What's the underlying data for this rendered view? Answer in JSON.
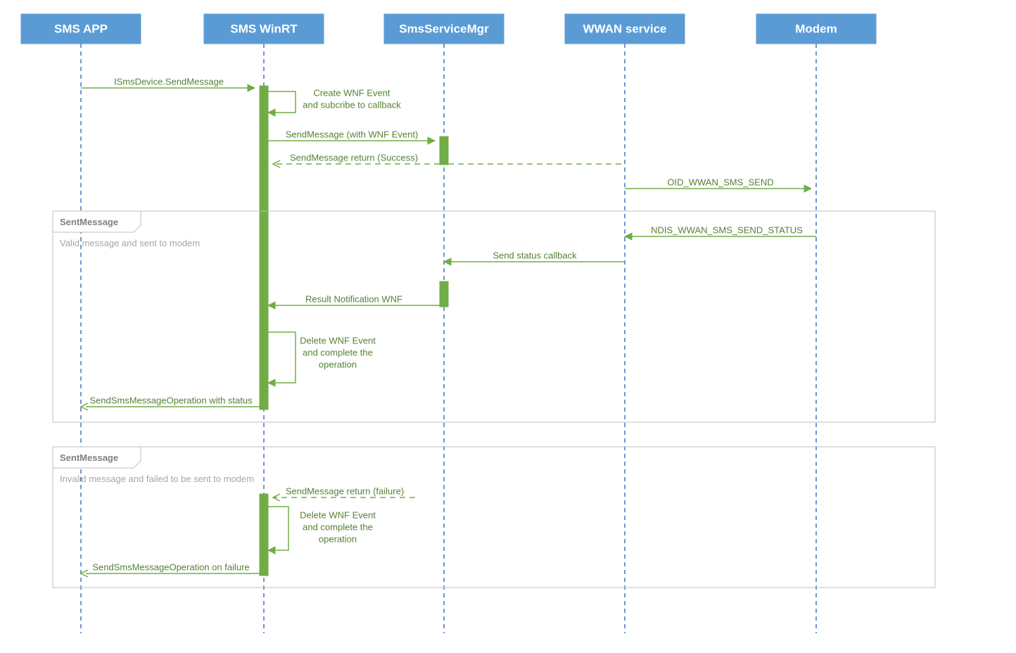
{
  "participants": {
    "p1": "SMS APP",
    "p2": "SMS WinRT",
    "p3": "SmsServiceMgr",
    "p4": "WWAN service",
    "p5": "Modem"
  },
  "messages": {
    "m1": "ISmsDevice.SendMessage",
    "m2a": "Create WNF Event",
    "m2b": "and subcribe to callback",
    "m3": "SendMessage (with WNF Event)",
    "m4": "SendMessage return (Success)",
    "m5": "OID_WWAN_SMS_SEND",
    "m6": "NDIS_WWAN_SMS_SEND_STATUS",
    "m7": "Send status callback",
    "m8": "Result Notification WNF",
    "m9a": "Delete WNF Event",
    "m9b": "and complete the",
    "m9c": "operation",
    "m10": "SendSmsMessageOperation with status",
    "m11": "SendMessage return (failure)",
    "m12a": "Delete WNF Event",
    "m12b": "and complete the",
    "m12c": "operation",
    "m13": "SendSmsMessageOperation on failure"
  },
  "frames": {
    "f1_label": "SentMessage",
    "f1_desc": "Valid message and sent to modem",
    "f2_label": "SentMessage",
    "f2_desc": "Invalid message and failed to be sent to modem"
  }
}
